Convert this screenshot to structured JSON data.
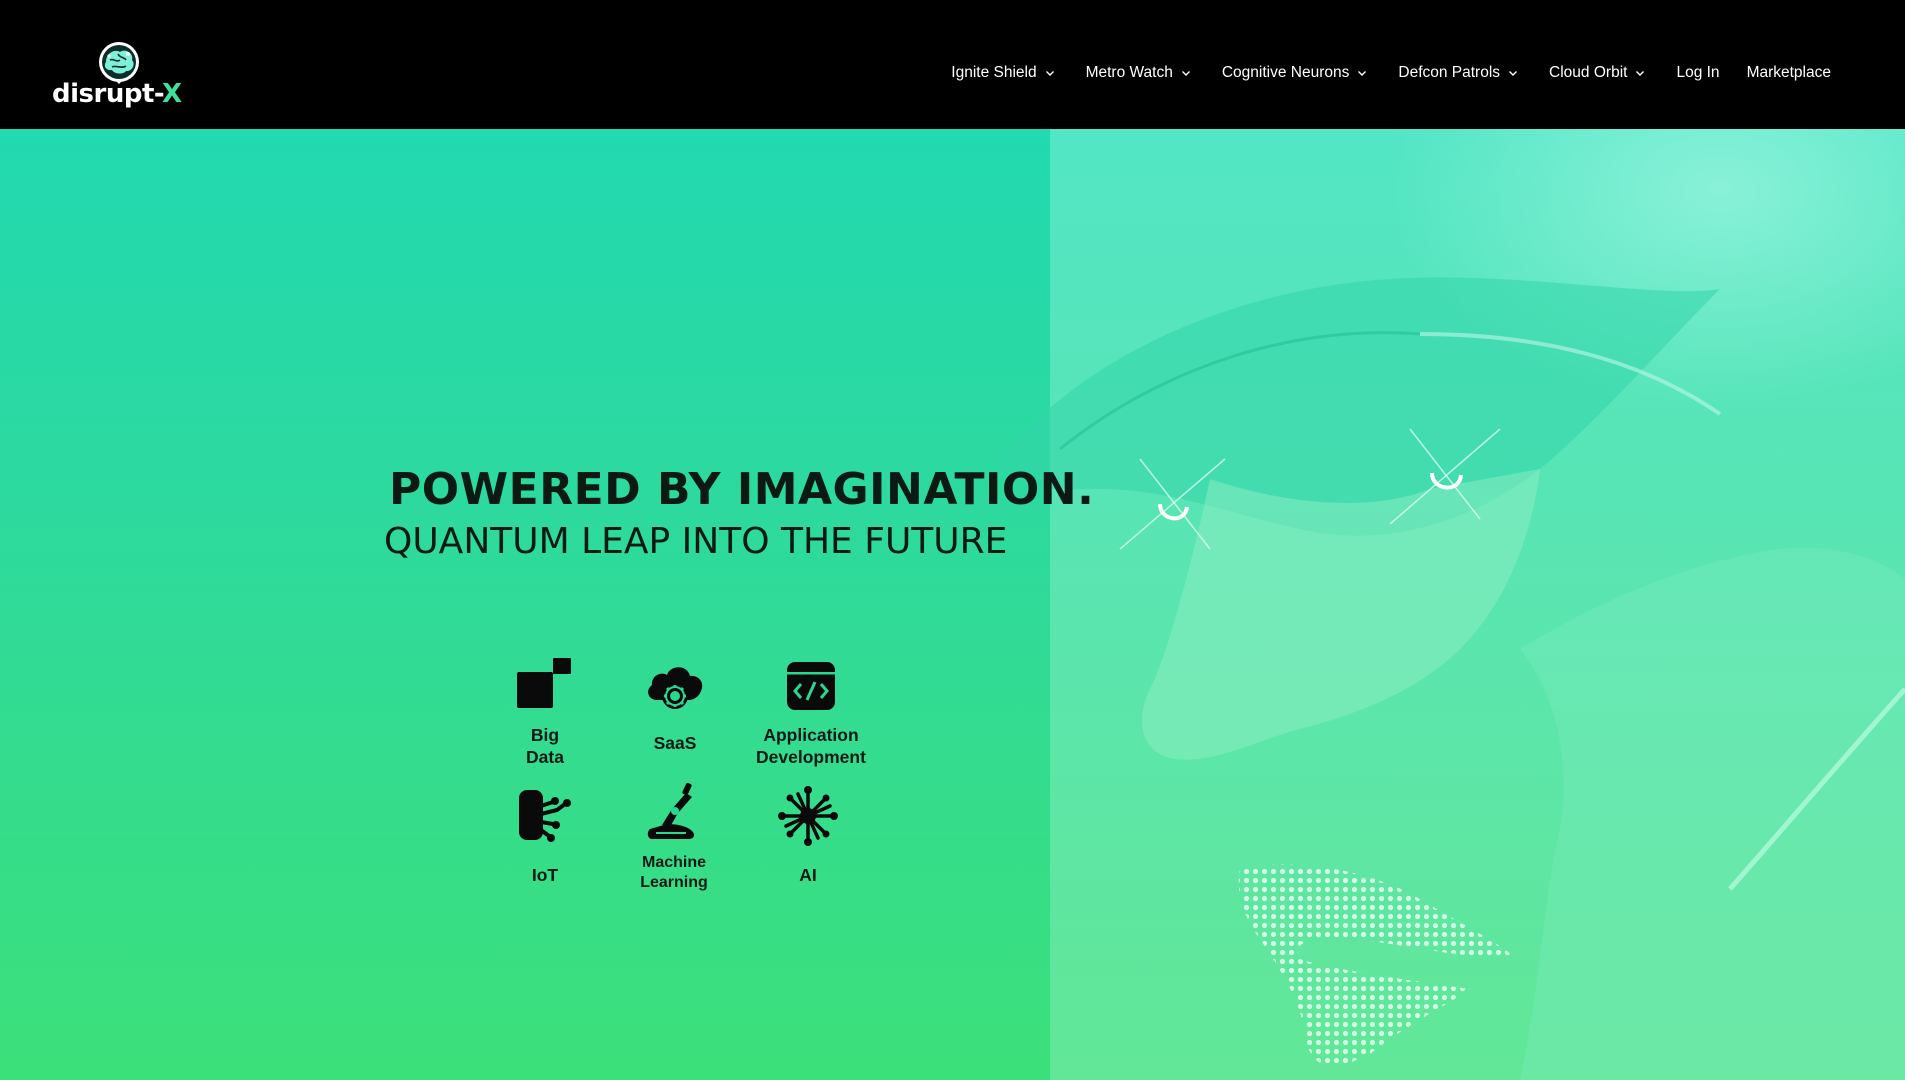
{
  "brand": {
    "name_main": "disrupt-",
    "name_accent": "X",
    "accent_color": "#3ee09a"
  },
  "nav": {
    "items": [
      {
        "label": "Ignite Shield",
        "has_dropdown": true
      },
      {
        "label": "Metro Watch",
        "has_dropdown": true
      },
      {
        "label": "Cognitive Neurons",
        "has_dropdown": true
      },
      {
        "label": "Defcon Patrols",
        "has_dropdown": true
      },
      {
        "label": "Cloud Orbit",
        "has_dropdown": true
      },
      {
        "label": "Log In",
        "has_dropdown": false
      },
      {
        "label": "Marketplace",
        "has_dropdown": false
      }
    ]
  },
  "hero": {
    "headline": "POWERED BY IMAGINATION.",
    "subheadline": "QUANTUM LEAP INTO THE FUTURE",
    "gradient_top": "#22d9b0",
    "gradient_bottom": "#3ce07a"
  },
  "services": [
    {
      "label": "Big Data",
      "icon": "big-data-icon"
    },
    {
      "label": "SaaS",
      "icon": "cloud-gear-icon"
    },
    {
      "label": "Application Development",
      "icon": "code-window-icon"
    },
    {
      "label": "IoT",
      "icon": "iot-hand-icon"
    },
    {
      "label": "Machine Learning",
      "icon": "robot-arm-icon"
    },
    {
      "label": "AI",
      "icon": "ai-burst-icon"
    }
  ]
}
